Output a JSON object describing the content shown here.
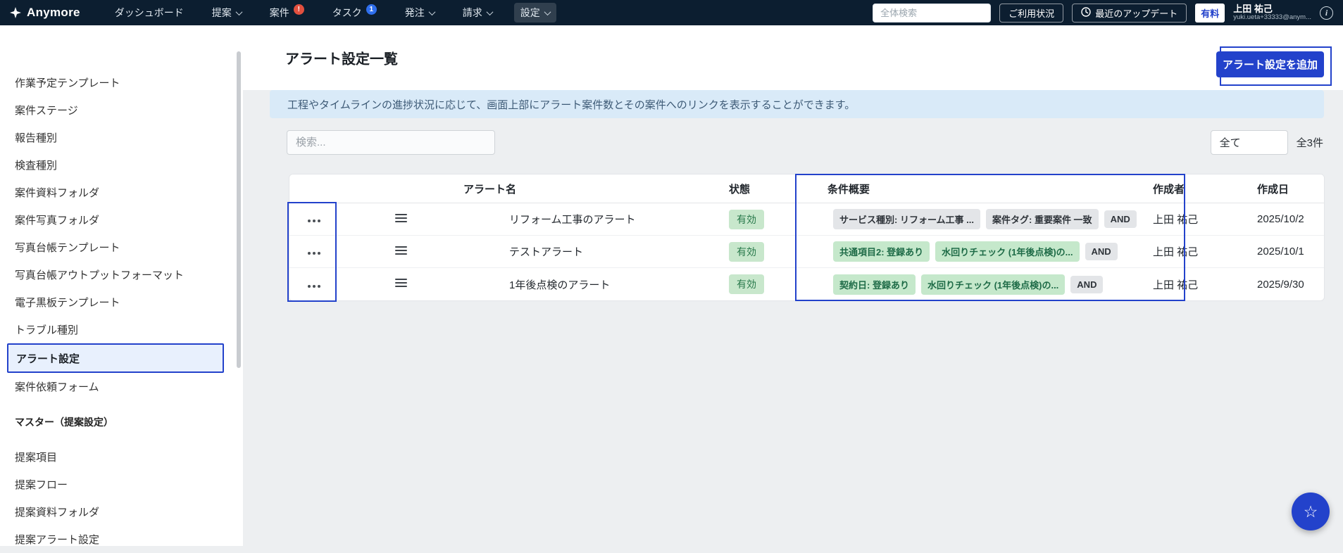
{
  "colors": {
    "accent": "#2342cb",
    "nav_bg": "#0c1e30",
    "page_bg": "#edeff1",
    "success_bg": "#c8e7cc",
    "success_text": "#27784a",
    "chip_green_bg": "#c5e8cb",
    "chip_green_text": "#1e6b47",
    "chip_gray_bg": "#e3e5e8",
    "chip_gray_text": "#2f343a",
    "banner_bg": "#d9eaf8",
    "banner_text": "#3d5a76",
    "alert_red": "#e2503f",
    "task_blue": "#2f6fed"
  },
  "icons": {
    "star": "☆",
    "info": "i"
  },
  "nav": {
    "brand": "Anymore",
    "items": [
      {
        "key": "dashboard",
        "label": "ダッシュボード"
      },
      {
        "key": "proposals",
        "label": "提案",
        "chevron": true
      },
      {
        "key": "cases",
        "label": "案件",
        "badge": "!",
        "badge_color": "#e2503f"
      },
      {
        "key": "tasks",
        "label": "タスク",
        "badge": "1",
        "badge_color": "#2f6fed"
      },
      {
        "key": "orders",
        "label": "発注",
        "chevron": true
      },
      {
        "key": "billing",
        "label": "請求",
        "chevron": true
      },
      {
        "key": "settings",
        "label": "設定",
        "chevron": true,
        "active": true
      }
    ],
    "search_placeholder": "全体検索",
    "usage_button": "ご利用状況",
    "updates_button": "最近のアップデート",
    "plan_badge": "有料",
    "user_name": "上田 祐己",
    "user_email": "yuki.ueta+33333@anym..."
  },
  "sidebar": {
    "items": [
      "作業予定テンプレート",
      "案件ステージ",
      "報告種別",
      "検査種別",
      "案件資料フォルダ",
      "案件写真フォルダ",
      "写真台帳テンプレート",
      "写真台帳アウトプットフォーマット",
      "電子黒板テンプレート",
      "トラブル種別",
      "アラート設定",
      "案件依頼フォーム"
    ],
    "selected": "アラート設定",
    "section_header": "マスター（提案設定）",
    "section_items": [
      "提案項目",
      "提案フロー",
      "提案資料フォルダ",
      "提案アラート設定"
    ]
  },
  "main": {
    "title": "アラート設定一覧",
    "add_button": "アラート設定を追加",
    "banner": "工程やタイムラインの進捗状況に応じて、画面上部にアラート案件数とその案件へのリンクを表示することができます。",
    "search_placeholder": "検索...",
    "filter_value": "全て",
    "count_label": "全3件",
    "table": {
      "headers": [
        "アラート名",
        "状態",
        "条件概要",
        "作成者",
        "作成日"
      ],
      "rows": [
        {
          "name": "リフォーム工事のアラート",
          "status": "有効",
          "conditions": [
            {
              "label": "サービス種別: リフォーム工事 ...",
              "type": "gray"
            },
            {
              "label": "案件タグ: 重要案件 一致",
              "type": "gray"
            },
            {
              "label": "AND",
              "type": "gray"
            }
          ],
          "author": "上田 祐己",
          "date": "2025/10/2"
        },
        {
          "name": "テストアラート",
          "status": "有効",
          "conditions": [
            {
              "label": "共通項目2: 登録あり",
              "type": "green"
            },
            {
              "label": "水回りチェック (1年後点検)の...",
              "type": "green"
            },
            {
              "label": "AND",
              "type": "gray"
            }
          ],
          "author": "上田 祐己",
          "date": "2025/10/1"
        },
        {
          "name": "1年後点検のアラート",
          "status": "有効",
          "conditions": [
            {
              "label": "契約日: 登録あり",
              "type": "green"
            },
            {
              "label": "水回りチェック (1年後点検)の...",
              "type": "green"
            },
            {
              "label": "AND",
              "type": "gray"
            }
          ],
          "author": "上田 祐己",
          "date": "2025/9/30"
        }
      ]
    }
  }
}
